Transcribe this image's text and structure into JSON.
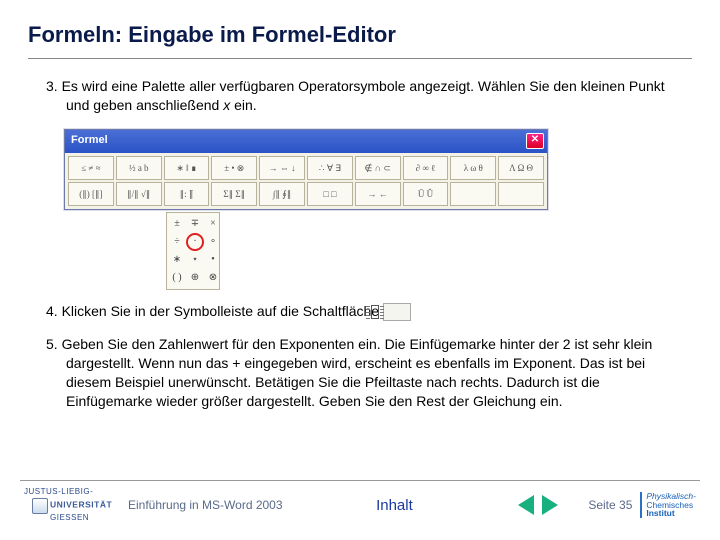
{
  "title": "Formeln: Eingabe im Formel-Editor",
  "items": {
    "i3": {
      "num": "3.",
      "pre": " Es wird eine Palette aller verfügbaren Operatorsymbole angezeigt. Wählen Sie den kleinen Punkt und geben anschließend ",
      "italic": "x",
      "post": " ein."
    },
    "i4": {
      "num": "4.",
      "text": " Klicken Sie in der Symbolleiste auf die Schaltfläche "
    },
    "i5": {
      "num": "5.",
      "text": " Geben Sie den Zahlenwert für den Exponenten ein. Die Einfügemarke hinter der 2 ist sehr klein dargestellt. Wenn nun das + eingegeben wird, erscheint es ebenfalls im Exponent. Das ist bei diesem Beispiel unerwünscht. Betätigen Sie die Pfeiltaste nach rechts. Dadurch ist die Einfügemarke wieder größer dargestellt. Geben Sie den Rest der Gleichung ein."
    }
  },
  "formel": {
    "title": "Formel",
    "row1": [
      "≤ ≠ ≈",
      "½ a b",
      "∗ ‖ ∎",
      "± • ⊗",
      "→ ⇔ ↓",
      "∴ ∀ ∃",
      "∉ ∩ ⊂",
      "∂ ∞ ℓ",
      "λ ω θ",
      "Λ Ω Θ"
    ],
    "row2": [
      "(∥) [∥]",
      "∥/∥ √∥",
      "∥: ∥̈",
      "Σ∥ Σ∥",
      "∫∥ ∮∥",
      "□ □",
      "→ ←",
      "Ū Û",
      "",
      ""
    ],
    "dropdown": [
      "±",
      "∓",
      "×",
      "÷",
      "·",
      "∘",
      "∗",
      "⋆",
      "•",
      "( )",
      "⊕",
      "⊗"
    ],
    "dropdown_highlight_index": 4
  },
  "footer": {
    "uni1": "JUSTUS-LIEBIG-",
    "uni2": "UNIVERSITÄT",
    "uni3": "GIESSEN",
    "course": "Einführung in MS-Word 2003",
    "inhalt": "Inhalt",
    "page": "Seite 35",
    "pci1": "Physikalisch-",
    "pci2": "Chemisches",
    "pci3": "Institut"
  }
}
